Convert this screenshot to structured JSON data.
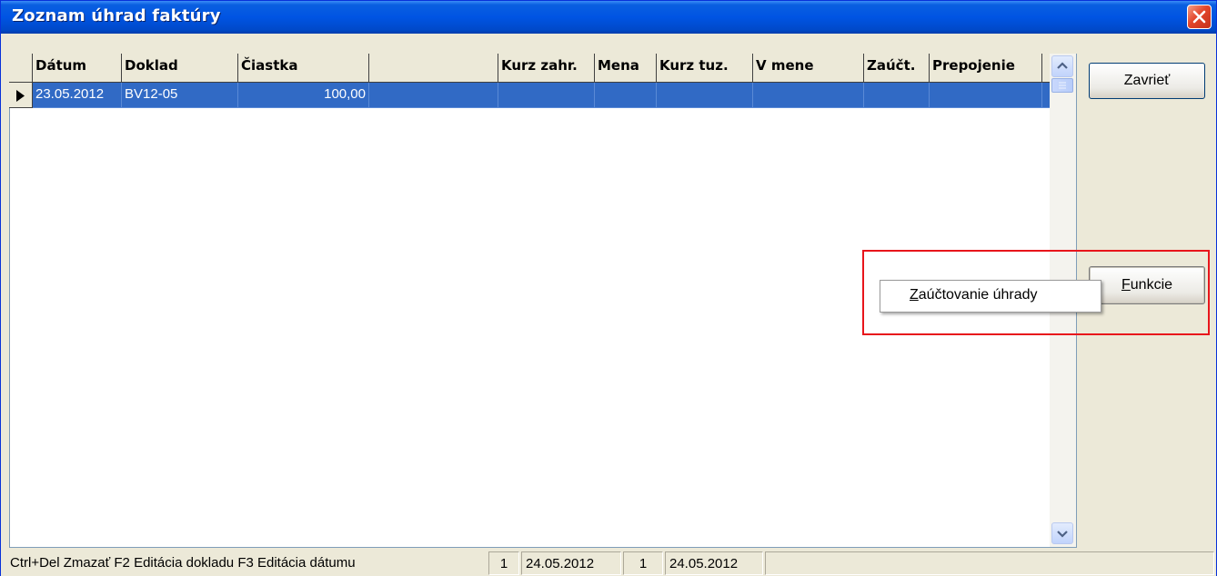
{
  "window": {
    "title": "Zoznam úhrad faktúry"
  },
  "grid": {
    "columns": [
      "Dátum",
      "Doklad",
      "Čiastka",
      "",
      "Kurz zahr.",
      "Mena",
      "Kurz tuz.",
      "V mene",
      "Zaúčt.",
      "Prepojenie"
    ],
    "rows": [
      {
        "cells": [
          "23.05.2012",
          "BV12-05",
          "100,00",
          "",
          "",
          "",
          "",
          "",
          "",
          ""
        ],
        "selected": true
      }
    ]
  },
  "buttons": {
    "close_label": "Zavrieť",
    "functions_label": "Funkcie"
  },
  "context_menu": {
    "items": [
      "Zaúčtovanie úhrady"
    ]
  },
  "statusbar": {
    "hint": "Ctrl+Del Zmazať  F2 Editácia dokladu  F3 Editácia dátumu",
    "count1": "1",
    "date1": "24.05.2012",
    "count2": "1",
    "date2": "24.05.2012"
  },
  "colors": {
    "titlebar": "#0054e3",
    "selection": "#316ac5",
    "highlight_border": "#e8151b",
    "close_button": "#e3452a"
  }
}
